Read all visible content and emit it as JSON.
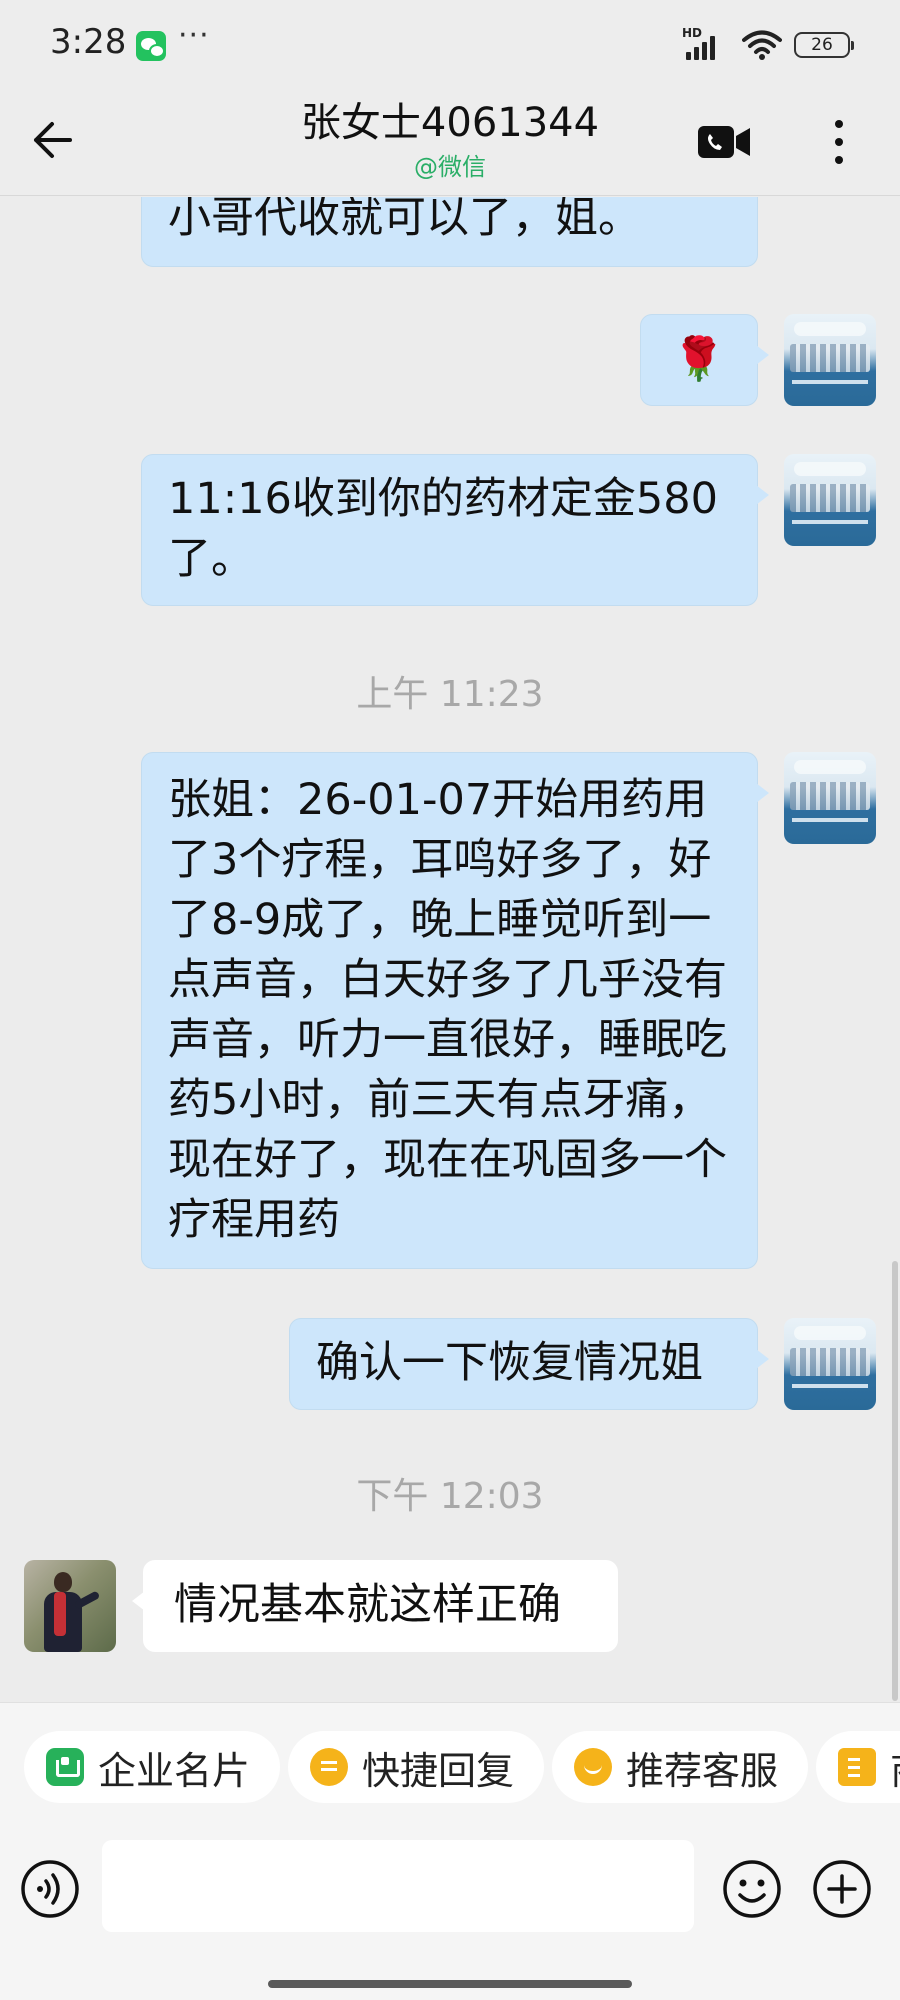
{
  "status_bar": {
    "time": "3:28",
    "dots": "···",
    "network_label": "HD",
    "battery": "26"
  },
  "header": {
    "title": "张女士4061344",
    "subtitle": "@微信"
  },
  "messages": {
    "m1": {
      "sender": "me",
      "text": "小哥代收就可以了，姐。"
    },
    "m2": {
      "sender": "me",
      "emoji": "🌹"
    },
    "m3": {
      "sender": "me",
      "text": "11:16收到你的药材定金580了。"
    },
    "ts1": "上午 11:23",
    "m4": {
      "sender": "me",
      "text": "张姐：26-01-07开始用药用了3个疗程，耳鸣好多了，好了8-9成了，晚上睡觉听到一点声音，白天好多了几乎没有声音，听力一直很好，睡眠吃药5小时，前三天有点牙痛，现在好了，现在在巩固多一个疗程用药"
    },
    "m5": {
      "sender": "me",
      "text": "确认一下恢复情况姐"
    },
    "ts2": "下午 12:03",
    "m6": {
      "sender": "contact",
      "text": "情况基本就这样正确"
    }
  },
  "quick_actions": {
    "business_card": "企业名片",
    "quick_reply": "快捷回复",
    "recommend_cs": "推荐客服",
    "shop": "商"
  },
  "input": {
    "value": "",
    "placeholder": ""
  },
  "colors": {
    "bubble_out": "#cde6fb",
    "bubble_in": "#ffffff",
    "wechat_green": "#2aae67",
    "background": "#ececec"
  }
}
